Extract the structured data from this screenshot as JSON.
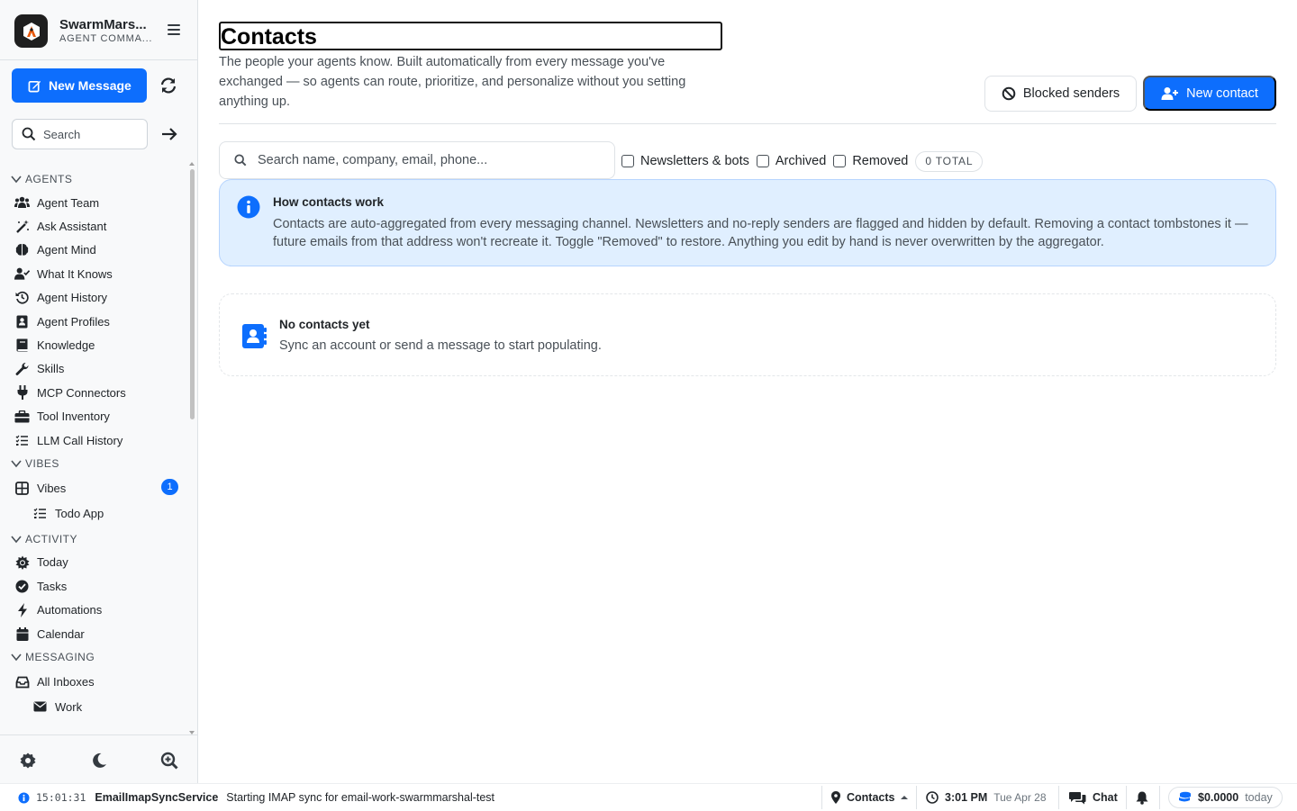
{
  "app": {
    "name": "SwarmMars...",
    "subtitle": "AGENT COMMA..."
  },
  "sidebar": {
    "new_message_label": "New Message",
    "search_placeholder": "Search",
    "sections": {
      "agents": "AGENTS",
      "vibes": "VIBES",
      "activity": "ACTIVITY",
      "messaging": "MESSAGING"
    },
    "agents_items": [
      {
        "label": "Agent Team",
        "icon": "users-icon"
      },
      {
        "label": "Ask Assistant",
        "icon": "magic-wand-icon"
      },
      {
        "label": "Agent Mind",
        "icon": "brain-icon"
      },
      {
        "label": "What It Knows",
        "icon": "user-check-icon"
      },
      {
        "label": "Agent History",
        "icon": "history-icon"
      },
      {
        "label": "Agent Profiles",
        "icon": "profile-card-icon"
      },
      {
        "label": "Knowledge",
        "icon": "book-icon"
      },
      {
        "label": "Skills",
        "icon": "wrench-icon"
      },
      {
        "label": "MCP Connectors",
        "icon": "plug-icon"
      },
      {
        "label": "Tool Inventory",
        "icon": "toolbox-icon"
      },
      {
        "label": "LLM Call History",
        "icon": "list-check-icon"
      }
    ],
    "vibes_items": [
      {
        "label": "Vibes",
        "icon": "grid-icon",
        "badge": "1"
      },
      {
        "label": "Todo App",
        "icon": "list-check-icon"
      }
    ],
    "activity_items": [
      {
        "label": "Today",
        "icon": "sun-icon"
      },
      {
        "label": "Tasks",
        "icon": "check-circle-icon"
      },
      {
        "label": "Automations",
        "icon": "bolt-icon"
      },
      {
        "label": "Calendar",
        "icon": "calendar-icon"
      }
    ],
    "messaging_items": [
      {
        "label": "All Inboxes",
        "icon": "inbox-icon"
      },
      {
        "label": "Work",
        "icon": "envelope-icon"
      }
    ]
  },
  "page": {
    "title": "Contacts",
    "description": "The people your agents know. Built automatically from every message you've exchanged — so agents can route, prioritize, and personalize without you setting anything up.",
    "blocked_label": "Blocked senders",
    "new_contact_label": "New contact",
    "search_placeholder": "Search name, company, email, phone...",
    "filters": {
      "newsletters": "Newsletters & bots",
      "archived": "Archived",
      "removed": "Removed",
      "total": "0 TOTAL"
    },
    "info": {
      "title": "How contacts work",
      "text": "Contacts are auto-aggregated from every messaging channel. Newsletters and no-reply senders are flagged and hidden by default. Removing a contact tombstones it — future emails from that address won't recreate it. Toggle \"Removed\" to restore. Anything you edit by hand is never overwritten by the aggregator."
    },
    "empty": {
      "title": "No contacts yet",
      "text": "Sync an account or send a message to start populating."
    }
  },
  "statusbar": {
    "log_time": "15:01:31",
    "log_service": "EmailImapSyncService",
    "log_message": "Starting IMAP sync for email-work-swarmmarshal-test",
    "location": "Contacts",
    "clock_time": "3:01 PM",
    "clock_date": "Tue Apr 28",
    "chat_label": "Chat",
    "cost": "$0.0000",
    "cost_period": "today"
  },
  "colors": {
    "accent": "#0d6efd",
    "info_bg": "#e0efff"
  }
}
